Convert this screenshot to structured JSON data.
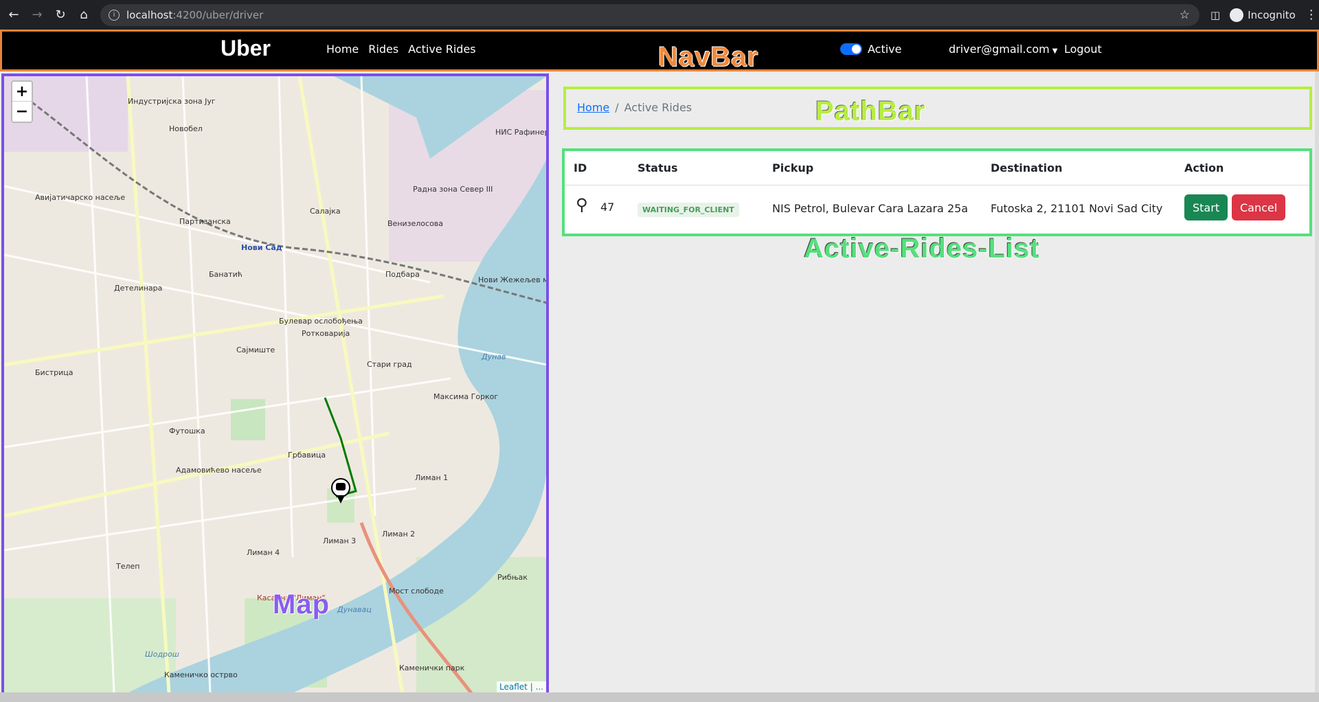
{
  "browser": {
    "url_host": "localhost",
    "url_path": ":4200/uber/driver",
    "profile": "Incognito"
  },
  "navbar": {
    "brand": "Uber",
    "links": [
      "Home",
      "Rides",
      "Active Rides"
    ],
    "active_label": "Active",
    "active_on": true,
    "user_email": "driver@gmail.com",
    "logout": "Logout",
    "annotation": "NavBar"
  },
  "map": {
    "annotation": "Map",
    "zoom_in": "+",
    "zoom_out": "−",
    "attribution": "Leaflet",
    "attribution_sep": " | ...",
    "labels": [
      "Индустријска зона Југ",
      "Новобел",
      "Авијатичарско насеље",
      "Салајка",
      "Радна зона Север III",
      "НИС Рафинерија нафте Нови Сад",
      "Нови Сад",
      "Банатић",
      "Детелинара",
      "Подбара",
      "Нови Жежељев мост",
      "Ротковарија",
      "Сајмиште",
      "Бистрица",
      "Стари град",
      "Футошка",
      "Грбавица",
      "Адамовићево насеље",
      "Лиман 1",
      "Лиман 2",
      "Лиман 3",
      "Лиман 4",
      "Телеп",
      "Касарна \"Лиман\"",
      "Мост слободе",
      "Рибњак",
      "Каменичко острво",
      "Каменички парк",
      "Дунав",
      "Партизанска",
      "Венизелосова",
      "Булевар ослобођења",
      "Максима Горког",
      "Дунавац",
      "Шодрош"
    ]
  },
  "pathbar": {
    "annotation": "PathBar",
    "home": "Home",
    "separator": "/",
    "current": "Active Rides"
  },
  "rides": {
    "annotation": "Active-Rides-List",
    "headers": [
      "ID",
      "Status",
      "Pickup",
      "Destination",
      "Action"
    ],
    "rows": [
      {
        "id": "47",
        "status": "WAITING_FOR_CLIENT",
        "pickup": "NIS Petrol, Bulevar Cara Lazara 25a",
        "destination": "Futoska 2, 21101 Novi Sad City",
        "start": "Start",
        "cancel": "Cancel"
      }
    ]
  },
  "colors": {
    "navbar_border": "#e8833a",
    "map_border": "#7b4fe6",
    "pathbar_border": "#b6ee42",
    "rides_border": "#55e07e",
    "start_btn": "#198754",
    "cancel_btn": "#dc3545",
    "route": "#007a00"
  }
}
